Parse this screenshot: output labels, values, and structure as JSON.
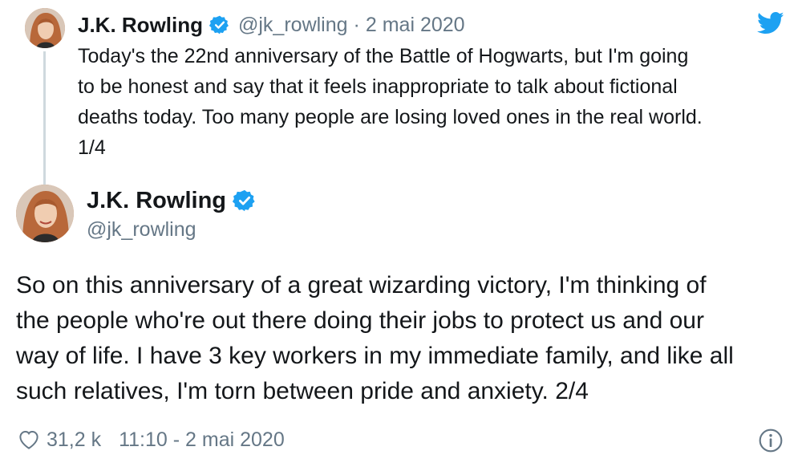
{
  "tweet1": {
    "author_name": "J.K. Rowling",
    "handle": "@jk_rowling",
    "separator": "·",
    "date": "2 mai 2020",
    "text_lines": [
      "Today's the 22nd anniversary of the Battle of Hogwarts, but I'm going",
      "to be honest and say that it feels inappropriate to talk about fictional",
      "deaths today. Too many people are losing loved ones in the real world.",
      "1/4"
    ]
  },
  "tweet2": {
    "author_name": "J.K. Rowling",
    "handle": "@jk_rowling",
    "text_lines": [
      "So on this anniversary of a great wizarding victory, I'm thinking of",
      "the people who're out there doing their jobs to protect us and our",
      "way of life. I have 3 key workers in my immediate family, and like all",
      "such relatives, I'm torn between pride and anxiety. 2/4"
    ],
    "likes": "31,2 k",
    "timestamp": "11:10 - 2 mai 2020"
  },
  "icons": {
    "verified": "verified-badge-icon",
    "bird": "twitter-bird-icon",
    "heart": "heart-icon",
    "info": "info-icon"
  },
  "colors": {
    "verified_blue": "#1da1f2",
    "secondary_text": "#657786",
    "primary_text": "#14171a",
    "thread_line": "#cfd9de"
  }
}
